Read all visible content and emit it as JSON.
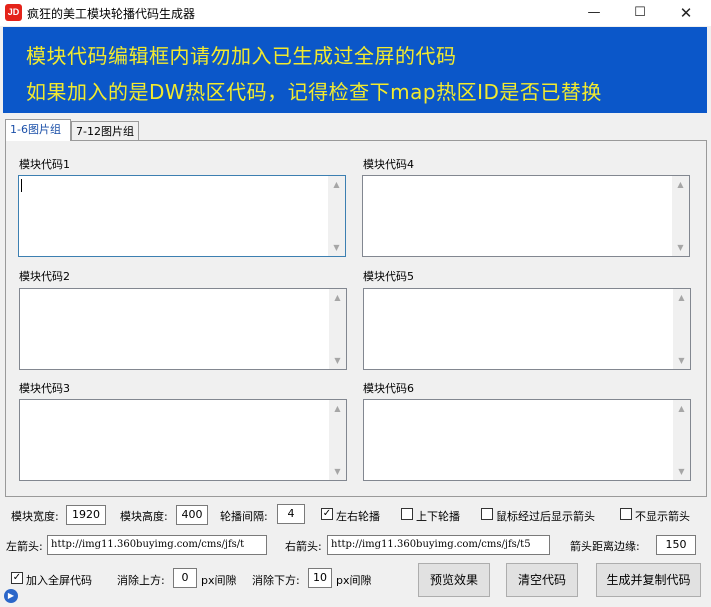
{
  "window": {
    "title": "疯狂的美工模块轮播代码生成器",
    "app_icon_text": "JD",
    "minimize": "—",
    "maximize": "☐",
    "close": "✕"
  },
  "banner": {
    "line1": "模块代码编辑框内请勿加入已生成过全屏的代码",
    "line2": "如果加入的是DW热区代码，记得检查下map热区ID是否已替换",
    "bg_color": "#0b57c9",
    "text_color": "#f2ea2e"
  },
  "tabs": [
    "1-6图片组",
    "7-12图片组"
  ],
  "modules": [
    "模块代码1",
    "模块代码2",
    "模块代码3",
    "模块代码4",
    "模块代码5",
    "模块代码6"
  ],
  "settings": {
    "width_label": "模块宽度:",
    "width_value": "1920",
    "height_label": "模块高度:",
    "height_value": "400",
    "interval_label": "轮播间隔:",
    "interval_value": "4",
    "lr_label": "左右轮播",
    "ud_label": "上下轮播",
    "hover_label": "鼠标经过后显示箭头",
    "noarrow_label": "不显示箭头",
    "left_arrow_label": "左箭头:",
    "left_arrow_value": "http://img11.360buyimg.com/cms/jfs/t",
    "right_arrow_label": "右箭头:",
    "right_arrow_value": "http://img11.360buyimg.com/cms/jfs/t5",
    "edge_label": "箭头距离边缘:",
    "edge_value": "150",
    "fullscreen_label": "加入全屏代码",
    "top_label": "消除上方:",
    "top_value": "0",
    "top_unit": "px间隙",
    "bottom_label": "消除下方:",
    "bottom_value": "10",
    "bottom_unit": "px间隙"
  },
  "checks": {
    "lr": true,
    "ud": false,
    "hover": false,
    "noarrow": false,
    "fullscreen": true
  },
  "buttons": {
    "preview": "预览效果",
    "clear": "清空代码",
    "generate": "生成并复制代码"
  }
}
